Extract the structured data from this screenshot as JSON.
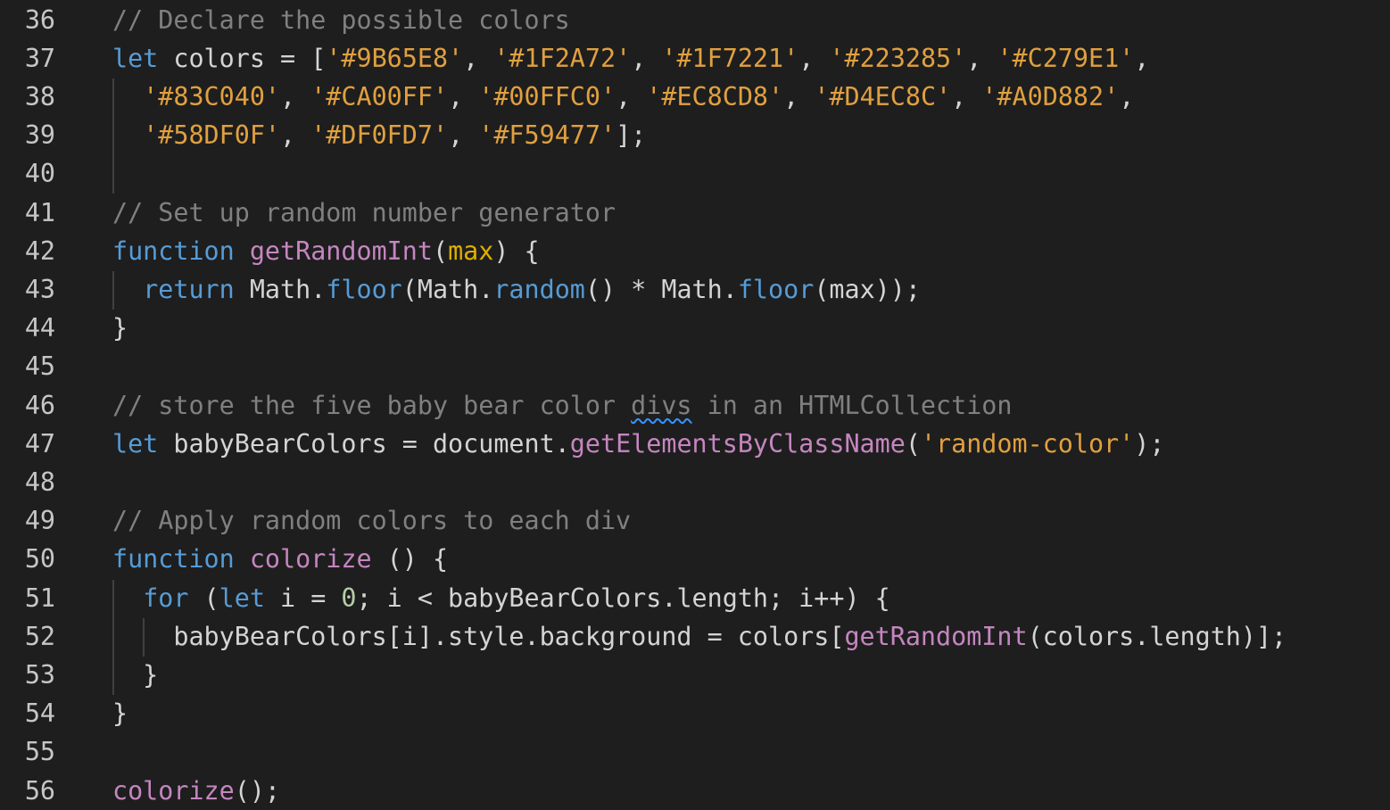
{
  "editor": {
    "lines": [
      {
        "num": "36",
        "tokens": [
          {
            "t": "// Declare the possible colors",
            "c": "ct"
          }
        ]
      },
      {
        "num": "37",
        "tokens": [
          {
            "t": "let",
            "c": "kw"
          },
          {
            "t": " colors = [",
            "c": ""
          },
          {
            "t": "'#9B65E8'",
            "c": "st"
          },
          {
            "t": ", ",
            "c": ""
          },
          {
            "t": "'#1F2A72'",
            "c": "st"
          },
          {
            "t": ", ",
            "c": ""
          },
          {
            "t": "'#1F7221'",
            "c": "st"
          },
          {
            "t": ", ",
            "c": ""
          },
          {
            "t": "'#223285'",
            "c": "st"
          },
          {
            "t": ", ",
            "c": ""
          },
          {
            "t": "'#C279E1'",
            "c": "st"
          },
          {
            "t": ",",
            "c": ""
          }
        ]
      },
      {
        "num": "38",
        "tokens": [
          {
            "t": "  ",
            "c": ""
          },
          {
            "t": "'#83C040'",
            "c": "st"
          },
          {
            "t": ", ",
            "c": ""
          },
          {
            "t": "'#CA00FF'",
            "c": "st"
          },
          {
            "t": ", ",
            "c": ""
          },
          {
            "t": "'#00FFC0'",
            "c": "st"
          },
          {
            "t": ", ",
            "c": ""
          },
          {
            "t": "'#EC8CD8'",
            "c": "st"
          },
          {
            "t": ", ",
            "c": ""
          },
          {
            "t": "'#D4EC8C'",
            "c": "st"
          },
          {
            "t": ", ",
            "c": ""
          },
          {
            "t": "'#A0D882'",
            "c": "st"
          },
          {
            "t": ",",
            "c": ""
          }
        ]
      },
      {
        "num": "39",
        "tokens": [
          {
            "t": "  ",
            "c": ""
          },
          {
            "t": "'#58DF0F'",
            "c": "st"
          },
          {
            "t": ", ",
            "c": ""
          },
          {
            "t": "'#DF0FD7'",
            "c": "st"
          },
          {
            "t": ", ",
            "c": ""
          },
          {
            "t": "'#F59477'",
            "c": "st"
          },
          {
            "t": "];",
            "c": ""
          }
        ]
      },
      {
        "num": "40",
        "tokens": []
      },
      {
        "num": "41",
        "tokens": [
          {
            "t": "// Set up random number generator",
            "c": "ct"
          }
        ]
      },
      {
        "num": "42",
        "tokens": [
          {
            "t": "function",
            "c": "kw"
          },
          {
            "t": " ",
            "c": ""
          },
          {
            "t": "getRandomInt",
            "c": "fn"
          },
          {
            "t": "(",
            "c": ""
          },
          {
            "t": "max",
            "c": "pa"
          },
          {
            "t": ") {",
            "c": ""
          }
        ]
      },
      {
        "num": "43",
        "tokens": [
          {
            "t": "  ",
            "c": ""
          },
          {
            "t": "return",
            "c": "kw"
          },
          {
            "t": " Math.",
            "c": ""
          },
          {
            "t": "floor",
            "c": "me"
          },
          {
            "t": "(Math.",
            "c": ""
          },
          {
            "t": "random",
            "c": "me"
          },
          {
            "t": "() * Math.",
            "c": ""
          },
          {
            "t": "floor",
            "c": "me"
          },
          {
            "t": "(max));",
            "c": ""
          }
        ]
      },
      {
        "num": "44",
        "tokens": [
          {
            "t": "}",
            "c": ""
          }
        ]
      },
      {
        "num": "45",
        "tokens": []
      },
      {
        "num": "46",
        "tokens": [
          {
            "t": "// store the five baby bear color ",
            "c": "ct"
          },
          {
            "t": "divs",
            "c": "ct squiggle"
          },
          {
            "t": " in an HTMLCollection",
            "c": "ct"
          }
        ]
      },
      {
        "num": "47",
        "tokens": [
          {
            "t": "let",
            "c": "kw"
          },
          {
            "t": " babyBearColors = document.",
            "c": ""
          },
          {
            "t": "getElementsByClassName",
            "c": "fn"
          },
          {
            "t": "(",
            "c": ""
          },
          {
            "t": "'random-color'",
            "c": "st"
          },
          {
            "t": ");",
            "c": ""
          }
        ]
      },
      {
        "num": "48",
        "tokens": []
      },
      {
        "num": "49",
        "tokens": [
          {
            "t": "// Apply random colors to each div",
            "c": "ct"
          }
        ]
      },
      {
        "num": "50",
        "tokens": [
          {
            "t": "function",
            "c": "kw"
          },
          {
            "t": " ",
            "c": ""
          },
          {
            "t": "colorize",
            "c": "fn"
          },
          {
            "t": " () {",
            "c": ""
          }
        ]
      },
      {
        "num": "51",
        "tokens": [
          {
            "t": "  ",
            "c": ""
          },
          {
            "t": "for",
            "c": "kw"
          },
          {
            "t": " (",
            "c": ""
          },
          {
            "t": "let",
            "c": "kw"
          },
          {
            "t": " i = ",
            "c": ""
          },
          {
            "t": "0",
            "c": "nm"
          },
          {
            "t": "; i < babyBearColors.length; i++) {",
            "c": ""
          }
        ]
      },
      {
        "num": "52",
        "tokens": [
          {
            "t": "    babyBearColors[i].style.background = colors[",
            "c": ""
          },
          {
            "t": "getRandomInt",
            "c": "fn"
          },
          {
            "t": "(colors.length)];",
            "c": ""
          }
        ]
      },
      {
        "num": "53",
        "tokens": [
          {
            "t": "  }",
            "c": ""
          }
        ]
      },
      {
        "num": "54",
        "tokens": [
          {
            "t": "}",
            "c": ""
          }
        ]
      },
      {
        "num": "55",
        "tokens": []
      },
      {
        "num": "56",
        "tokens": [
          {
            "t": "colorize",
            "c": "fn"
          },
          {
            "t": "();",
            "c": ""
          }
        ]
      }
    ]
  },
  "colors": {
    "background": "#1e1e1e",
    "keyword": "#569cd6",
    "function": "#c586c0",
    "comment": "#808080",
    "string": "#e0a040",
    "number": "#b5cea8"
  }
}
